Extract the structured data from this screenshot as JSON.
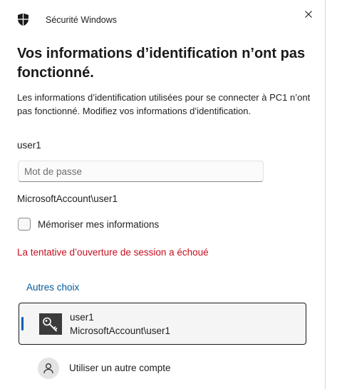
{
  "window": {
    "title": "Sécurité Windows",
    "icon": "shield-icon",
    "close_icon": "close-icon"
  },
  "main": {
    "heading": "Vos informations d’identification n’ont pas fonctionné.",
    "description": "Les informations d’identification utilisées pour se connecter à PC1 n’ont pas fonctionné. Modifiez vos informations d’identification.",
    "username": "user1",
    "password": {
      "value": "",
      "placeholder": "Mot de passe"
    },
    "domain_user": "MicrosoftAccount\\user1",
    "remember": {
      "label": "Mémoriser mes informations",
      "checked": false
    },
    "error": "La tentative d’ouverture de session a échoué"
  },
  "choices": {
    "label": "Autres choix",
    "items": [
      {
        "name": "user1",
        "domain": "MicrosoftAccount\\user1",
        "icon": "key-icon",
        "selected": true
      },
      {
        "label": "Utiliser un autre compte",
        "icon": "person-icon",
        "selected": false
      }
    ]
  },
  "colors": {
    "error": "#c50f1f",
    "link": "#005a9e",
    "accent": "#005fb8",
    "key_tile": "#3b3b3b"
  }
}
